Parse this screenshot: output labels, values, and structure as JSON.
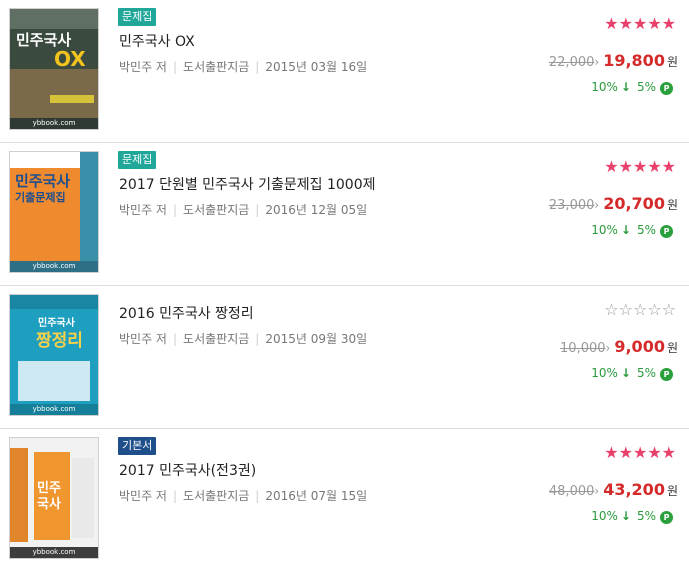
{
  "colors": {
    "star_on": "#e8416b",
    "sale_price": "#d42a2a",
    "reward_green": "#2a9a3a",
    "badge_teal": "#21a79a",
    "badge_navy": "#1f4f8a"
  },
  "books": [
    {
      "badge": "문제집",
      "title": "민주국사 OX",
      "author": "박민주 저",
      "publisher": "도서출판지금",
      "date": "2015년 03월 16일",
      "rating": 5,
      "original_price": "22,000",
      "sale_price": "19,800",
      "currency": "원",
      "discount": "10%",
      "points": "5%",
      "cover": {
        "title": "민주국사",
        "subtitle": "OX",
        "publisher": "ybbook.com"
      }
    },
    {
      "badge": "문제집",
      "title": "2017 단원별 민주국사 기출문제집 1000제",
      "author": "박민주 저",
      "publisher": "도서출판지금",
      "date": "2016년 12월 05일",
      "rating": 5,
      "original_price": "23,000",
      "sale_price": "20,700",
      "currency": "원",
      "discount": "10%",
      "points": "5%",
      "cover": {
        "title": "민주국사",
        "subtitle": "기출문제집",
        "publisher": "ybbook.com"
      }
    },
    {
      "badge": "",
      "title": "2016 민주국사 짱정리",
      "author": "박민주 저",
      "publisher": "도서출판지금",
      "date": "2015년 09월 30일",
      "rating": 0,
      "original_price": "10,000",
      "sale_price": "9,000",
      "currency": "원",
      "discount": "10%",
      "points": "5%",
      "cover": {
        "title": "민주국사",
        "subtitle": "짱정리",
        "publisher": "ybbook.com"
      }
    },
    {
      "badge": "기본서",
      "title": "2017 민주국사(전3권)",
      "author": "박민주 저",
      "publisher": "도서출판지금",
      "date": "2016년 07월 15일",
      "rating": 5,
      "original_price": "48,000",
      "sale_price": "43,200",
      "currency": "원",
      "discount": "10%",
      "points": "5%",
      "cover": {
        "title": "민주",
        "subtitle": "국사",
        "publisher": "ybbook.com"
      }
    }
  ]
}
